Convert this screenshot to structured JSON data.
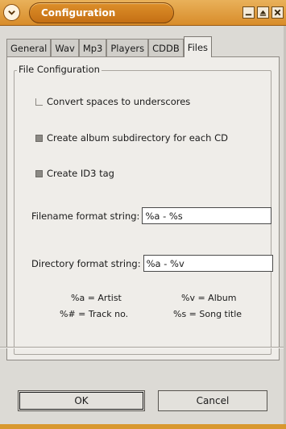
{
  "window": {
    "title": "Configuration",
    "accent_color": "#d88c2a",
    "buttons": [
      "minimize-icon",
      "maximize-icon",
      "close-icon"
    ]
  },
  "tabs": [
    {
      "label": "General",
      "active": false
    },
    {
      "label": "Wav",
      "active": false
    },
    {
      "label": "Mp3",
      "active": false
    },
    {
      "label": "Players",
      "active": false
    },
    {
      "label": "CDDB",
      "active": false
    },
    {
      "label": "Files",
      "active": true
    }
  ],
  "group": {
    "title": "File Configuration",
    "options": [
      {
        "label": "Convert spaces to underscores",
        "checked": false
      },
      {
        "label": "Create album subdirectory for each CD",
        "checked": true
      },
      {
        "label": "Create ID3 tag",
        "checked": true
      }
    ],
    "filename_format": {
      "label": "Filename format string:",
      "value": "%a - %s"
    },
    "directory_format": {
      "label": "Directory format string:",
      "value": "%a - %v"
    },
    "legend": [
      {
        "key": "%a = Artist"
      },
      {
        "key": "%v = Album"
      },
      {
        "key": "%# = Track no."
      },
      {
        "key": "%s = Song title"
      }
    ]
  },
  "actions": {
    "ok": "OK",
    "cancel": "Cancel"
  }
}
